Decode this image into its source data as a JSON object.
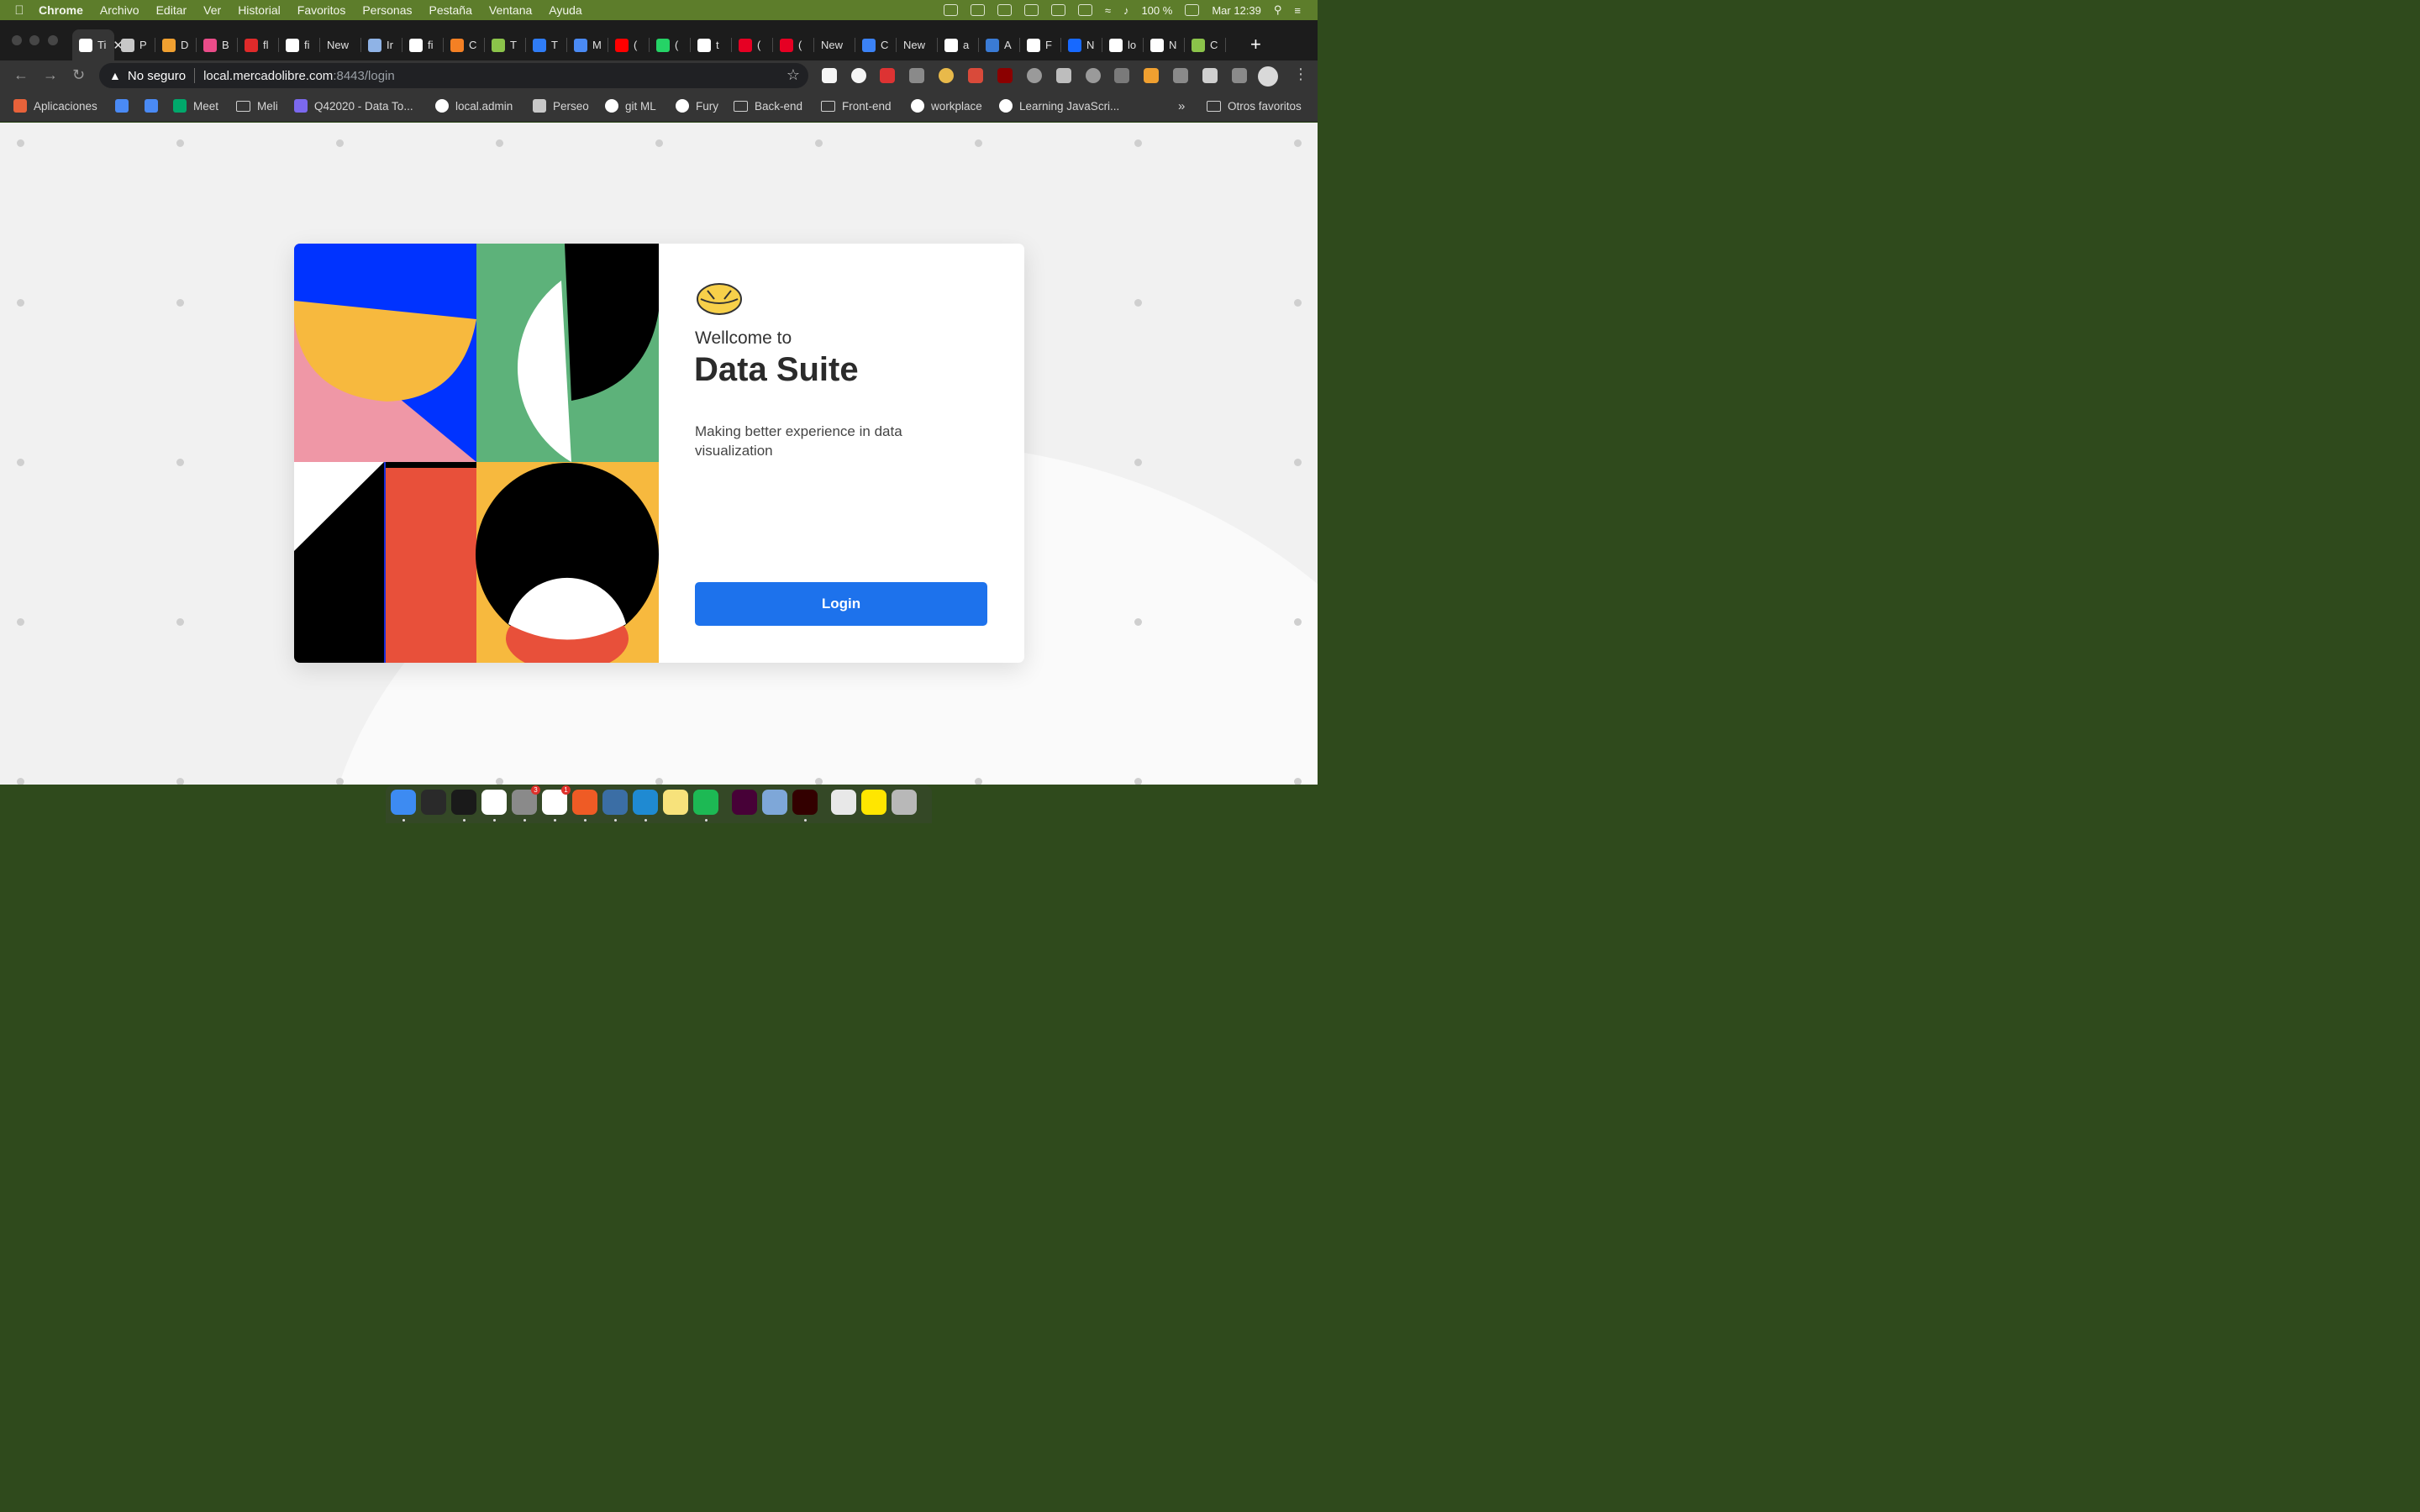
{
  "menubar": {
    "app_name": "Chrome",
    "items": [
      "Archivo",
      "Editar",
      "Ver",
      "Historial",
      "Favoritos",
      "Personas",
      "Pestaña",
      "Ventana",
      "Ayuda"
    ],
    "battery": "100 %",
    "clock": "Mar 12:39"
  },
  "tabs": [
    {
      "label": "Ti",
      "active": true,
      "color": "#ffffff"
    },
    {
      "label": "P",
      "color": "#c8c8c8"
    },
    {
      "label": "D",
      "color": "#f0a030"
    },
    {
      "label": "B",
      "color": "#ea4c89"
    },
    {
      "label": "fl",
      "color": "#e02a2a"
    },
    {
      "label": "fi",
      "color": "#ffffff"
    },
    {
      "label": "New",
      "color": ""
    },
    {
      "label": "Ir",
      "color": "#8fb3e6"
    },
    {
      "label": "fi",
      "color": "#ffffff"
    },
    {
      "label": "C",
      "color": "#f48024"
    },
    {
      "label": "T",
      "color": "#8bc34a"
    },
    {
      "label": "T",
      "color": "#2f7cf6"
    },
    {
      "label": "M",
      "color": "#4a8af4"
    },
    {
      "label": "(",
      "color": "#ff0000"
    },
    {
      "label": "(",
      "color": "#25d366"
    },
    {
      "label": "t",
      "color": "#ffffff"
    },
    {
      "label": "(",
      "color": "#e60023"
    },
    {
      "label": "(",
      "color": "#e60023"
    },
    {
      "label": "New",
      "color": ""
    },
    {
      "label": "C",
      "color": "#3b82f6"
    },
    {
      "label": "New",
      "color": ""
    },
    {
      "label": "a",
      "color": "#ffffff"
    },
    {
      "label": "A",
      "color": "#3a7bd5"
    },
    {
      "label": "F",
      "color": "#ffffff"
    },
    {
      "label": "N",
      "color": "#1769ff"
    },
    {
      "label": "lo",
      "color": "#ffffff"
    },
    {
      "label": "N",
      "color": "#ffffff"
    },
    {
      "label": "C",
      "color": "#8bc34a"
    }
  ],
  "address_bar": {
    "security_label": "No seguro",
    "host": "local.mercadolibre.com",
    "path": ":8443/login"
  },
  "bookmarks": [
    {
      "label": "Aplicaciones",
      "icon": "apps-grid-icon",
      "color": "#e8623a"
    },
    {
      "label": "",
      "icon": "calendar-icon",
      "color": "#4a8af4"
    },
    {
      "label": "",
      "icon": "translate-icon",
      "color": "#4a8af4"
    },
    {
      "label": "Meet",
      "icon": "meet-icon",
      "color": "#00a86b"
    },
    {
      "label": "Meli",
      "icon": "folder-icon",
      "color": ""
    },
    {
      "label": "Q42020 - Data To...",
      "icon": "clickup-icon",
      "color": "#7b68ee"
    },
    {
      "label": "local.admin",
      "icon": "local-admin-icon",
      "color": "#ffffff"
    },
    {
      "label": "Perseo",
      "icon": "perseo-icon",
      "color": "#c8c8c8"
    },
    {
      "label": "git ML",
      "icon": "github-icon",
      "color": "#ffffff"
    },
    {
      "label": "Fury",
      "icon": "fury-icon",
      "color": "#ffffff"
    },
    {
      "label": "Back-end",
      "icon": "folder-icon",
      "color": ""
    },
    {
      "label": "Front-end",
      "icon": "folder-icon",
      "color": ""
    },
    {
      "label": "workplace",
      "icon": "workplace-icon",
      "color": "#ffffff"
    },
    {
      "label": "Learning JavaScri...",
      "icon": "globe-icon",
      "color": "#ffffff"
    }
  ],
  "bookmarks_overflow": "»",
  "bookmarks_other": "Otros favoritos",
  "login_card": {
    "welcome": "Wellcome to",
    "title": "Data Suite",
    "tagline": "Making better experience in data visualization",
    "login_button": "Login"
  },
  "dock": [
    {
      "name": "finder",
      "color": "#3d8bf2",
      "running": true
    },
    {
      "name": "activity-monitor",
      "color": "#2a2a2a",
      "running": false
    },
    {
      "name": "terminal",
      "color": "#1a1a1a",
      "running": true
    },
    {
      "name": "chrome",
      "color": "#ffffff",
      "running": true
    },
    {
      "name": "system-preferences",
      "color": "#8a8a8a",
      "running": true,
      "badge": "3"
    },
    {
      "name": "slack",
      "color": "#ffffff",
      "running": true,
      "badge": "1"
    },
    {
      "name": "postman",
      "color": "#ef5b25",
      "running": true
    },
    {
      "name": "mysql-workbench",
      "color": "#3b6ea5",
      "running": true
    },
    {
      "name": "vscode",
      "color": "#1f8ad2",
      "running": true
    },
    {
      "name": "notes",
      "color": "#f7e27b",
      "running": false
    },
    {
      "name": "spotify",
      "color": "#1db954",
      "running": true
    },
    {
      "name": "adobe-xd",
      "color": "#470137",
      "running": false
    },
    {
      "name": "preview",
      "color": "#7ea7d8",
      "running": false
    },
    {
      "name": "adobe-illustrator",
      "color": "#330000",
      "running": true
    },
    {
      "name": "mercado-libre-folder",
      "color": "#e8e8e8",
      "running": false
    },
    {
      "name": "mercado-libre-handshake",
      "color": "#ffe600",
      "running": false
    },
    {
      "name": "trash",
      "color": "#b8b8b8",
      "running": false
    }
  ],
  "colors": {
    "brand_blue": "#1d72ec",
    "art_blue": "#0033ff",
    "art_yellow": "#f7b93e",
    "art_green": "#5db27a",
    "art_pink": "#ef97a6",
    "art_red": "#e8503a"
  }
}
